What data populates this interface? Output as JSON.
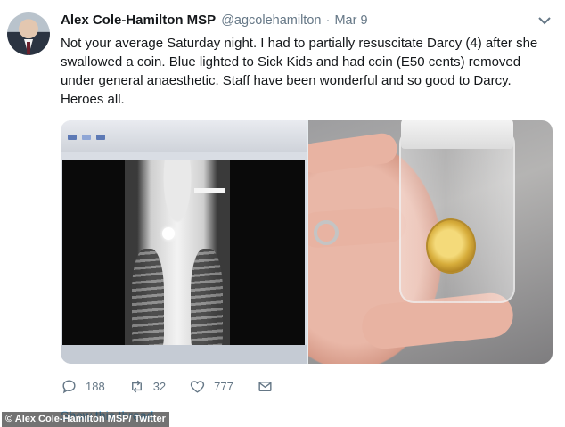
{
  "author": {
    "name": "Alex Cole-Hamilton MSP",
    "handle": "@agcolehamilton",
    "separator": "·",
    "date": "Mar 9"
  },
  "tweet": {
    "text": "Not your average Saturday night. I had to partially resuscitate Darcy (4) after she swallowed a coin. Blue lighted to Sick Kids and had coin (E50 cents) removed under general anaesthetic. Staff have been wonderful and so good to Darcy. Heroes all."
  },
  "media": {
    "left_image": "x-ray-chest-with-coin",
    "right_image": "coin-in-specimen-jar"
  },
  "actions": {
    "replies": "188",
    "retweets": "32",
    "likes": "777"
  },
  "icons": {
    "reply": "reply-icon",
    "retweet": "retweet-icon",
    "like": "heart-icon",
    "message": "message-icon",
    "menu": "chevron-down-icon"
  },
  "footer": {
    "show_thread": "Show this thread",
    "credit": "© Alex Cole-Hamilton MSP/ Twitter"
  },
  "colors": {
    "text": "#14171a",
    "muted": "#657786",
    "link": "#1da1f2"
  }
}
